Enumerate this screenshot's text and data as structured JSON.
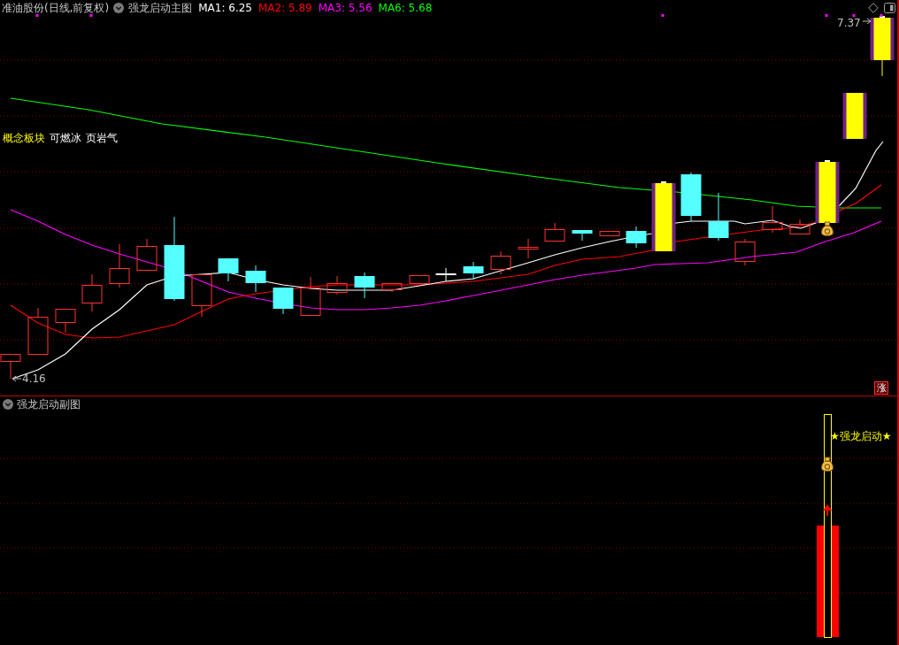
{
  "main_chart": {
    "security_title": "准油股份(日线,前复权)",
    "indicator_name": "强龙启动主图",
    "moving_averages": [
      {
        "text": "MA1: 6.25",
        "color": "#ffffff"
      },
      {
        "text": "MA2: 5.89",
        "color": "#ff0000"
      },
      {
        "text": "MA3: 5.56",
        "color": "#ff00ff"
      },
      {
        "text": "MA6: 5.68",
        "color": "#00ff00"
      }
    ],
    "concept": {
      "label": "概念板块",
      "tags": [
        "可燃冰",
        "页岩气"
      ]
    },
    "high_price": "7.37",
    "low_price": "4.16",
    "side_button": "涨"
  },
  "sub_chart": {
    "indicator_name": "强龙启动副图",
    "signal_label": "★强龙启动★"
  }
}
